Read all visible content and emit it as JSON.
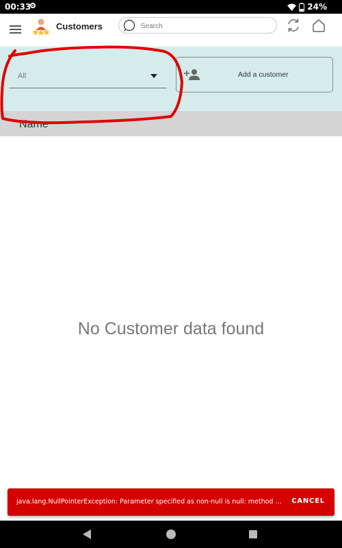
{
  "status_bar": {
    "time": "00:33",
    "battery": "24%"
  },
  "app_bar": {
    "title": "Customers",
    "search": {
      "placeholder": "Search",
      "value": ""
    }
  },
  "filter": {
    "selected": "All",
    "add_button_label": "Add a customer"
  },
  "table": {
    "columns": [
      "Name"
    ]
  },
  "empty_state": "No Customer data found",
  "snackbar": {
    "message": "java.lang.NullPointerException: Parameter specified as non-null is null: method com....",
    "action": "CANCEL"
  },
  "colors": {
    "panel": "#d6ecec",
    "header": "#d4d4d4",
    "error": "#d50000",
    "annotation": "#e00000"
  },
  "icons": [
    "menu-icon",
    "customers-logo-icon",
    "search-icon",
    "refresh-icon",
    "home-icon",
    "caret-down-icon",
    "add-person-icon",
    "back-icon",
    "home-nav-icon",
    "recents-icon"
  ]
}
